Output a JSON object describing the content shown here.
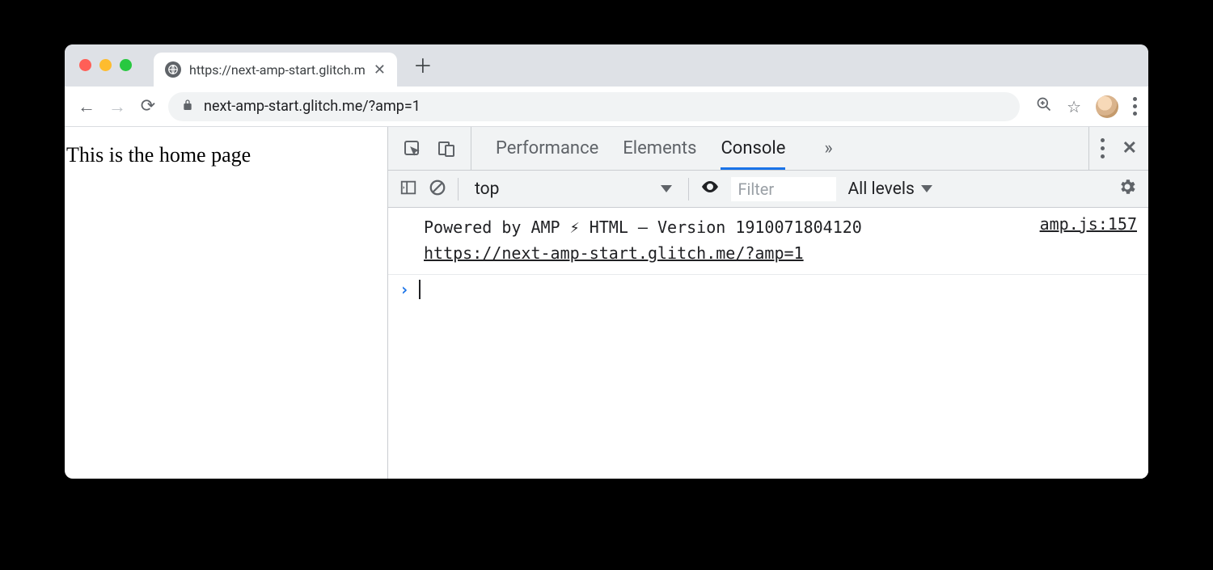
{
  "tab": {
    "title": "https://next-amp-start.glitch.m"
  },
  "address_bar": {
    "url": "next-amp-start.glitch.me/?amp=1"
  },
  "page": {
    "heading": "This is the home page"
  },
  "devtools": {
    "tabs": {
      "performance": "Performance",
      "elements": "Elements",
      "console": "Console"
    },
    "console_bar": {
      "context": "top",
      "filter_placeholder": "Filter",
      "levels": "All levels"
    },
    "log": {
      "message": "Powered by AMP ⚡ HTML – Version 1910071804120",
      "url": "https://next-amp-start.glitch.me/?amp=1",
      "source": "amp.js:157"
    }
  }
}
